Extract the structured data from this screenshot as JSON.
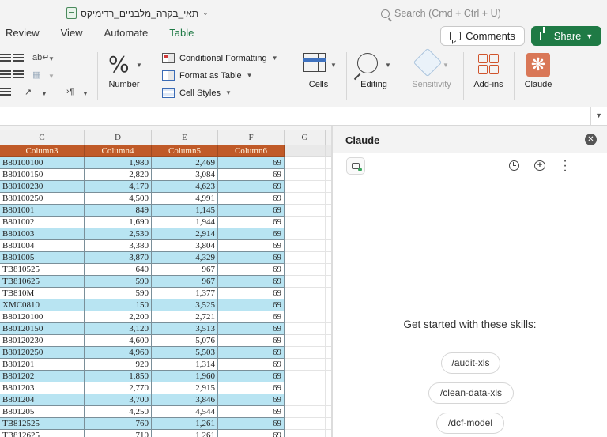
{
  "window": {
    "doc_title": "תאי_בקרה_מלבניים_רדימיקס",
    "search_placeholder": "Search (Cmd + Ctrl + U)"
  },
  "menu": {
    "tabs": [
      {
        "label": "Review"
      },
      {
        "label": "View"
      },
      {
        "label": "Automate"
      },
      {
        "label": "Table",
        "active": true
      }
    ],
    "comments_label": "Comments",
    "share_label": "Share"
  },
  "ribbon": {
    "number_label": "Number",
    "number_glyph": "%",
    "conditional_formatting": "Conditional Formatting",
    "format_as_table": "Format as Table",
    "cell_styles": "Cell Styles",
    "cells_label": "Cells",
    "editing_label": "Editing",
    "sensitivity_label": "Sensitivity",
    "addins_label": "Add-ins",
    "claude_label": "Claude"
  },
  "sheet": {
    "column_letters": [
      "C",
      "D",
      "E",
      "F",
      "G"
    ],
    "header": [
      "Column3",
      "Column4",
      "Column5",
      "Column6"
    ],
    "rows": [
      [
        "B80100100",
        "1,980",
        "2,469",
        "69"
      ],
      [
        "B80100150",
        "2,820",
        "3,084",
        "69"
      ],
      [
        "B80100230",
        "4,170",
        "4,623",
        "69"
      ],
      [
        "B80100250",
        "4,500",
        "4,991",
        "69"
      ],
      [
        "B801001",
        "849",
        "1,145",
        "69"
      ],
      [
        "B801002",
        "1,690",
        "1,944",
        "69"
      ],
      [
        "B801003",
        "2,530",
        "2,914",
        "69"
      ],
      [
        "B801004",
        "3,380",
        "3,804",
        "69"
      ],
      [
        "B801005",
        "3,870",
        "4,329",
        "69"
      ],
      [
        "TB810525",
        "640",
        "967",
        "69"
      ],
      [
        "TB810625",
        "590",
        "967",
        "69"
      ],
      [
        "TB810M",
        "590",
        "1,377",
        "69"
      ],
      [
        "XMC0810",
        "150",
        "3,525",
        "69"
      ],
      [
        "B80120100",
        "2,200",
        "2,721",
        "69"
      ],
      [
        "B80120150",
        "3,120",
        "3,513",
        "69"
      ],
      [
        "B80120230",
        "4,600",
        "5,076",
        "69"
      ],
      [
        "B80120250",
        "4,960",
        "5,503",
        "69"
      ],
      [
        "B801201",
        "920",
        "1,314",
        "69"
      ],
      [
        "B801202",
        "1,850",
        "1,960",
        "69"
      ],
      [
        "B801203",
        "2,770",
        "2,915",
        "69"
      ],
      [
        "B801204",
        "3,700",
        "3,846",
        "69"
      ],
      [
        "B801205",
        "4,250",
        "4,544",
        "69"
      ],
      [
        "TB812525",
        "760",
        "1,261",
        "69"
      ],
      [
        "TB812625",
        "710",
        "1,261",
        "69"
      ]
    ]
  },
  "panel": {
    "title": "Claude",
    "skills_heading": "Get started with these skills:",
    "skills": [
      "/audit-xls",
      "/clean-data-xls",
      "/dcf-model"
    ]
  },
  "colors": {
    "accent_green": "#1f7a45",
    "table_header": "#c05a28",
    "band_blue": "#b8e4f2",
    "claude_orange": "#d97757"
  }
}
